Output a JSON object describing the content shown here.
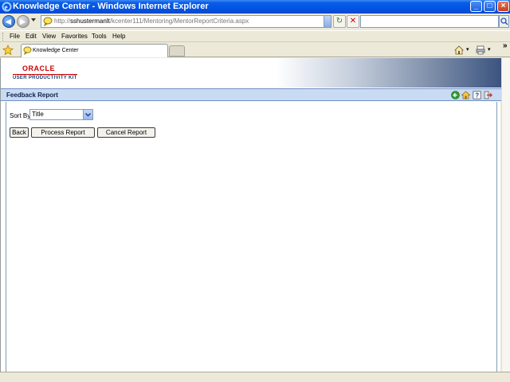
{
  "window": {
    "title": "Knowledge Center - Windows Internet Explorer",
    "min_icon": "minimize-icon",
    "max_icon": "maximize-icon",
    "close_icon": "close-icon"
  },
  "address": {
    "prefix": "http://",
    "host": "sshustermanlt",
    "path": "/kcenter111/Mentoring/MentorReportCriteria.aspx"
  },
  "menu": [
    "File",
    "Edit",
    "View",
    "Favorites",
    "Tools",
    "Help"
  ],
  "tab": {
    "label": "Knowledge Center"
  },
  "page": {
    "logo": "ORACLE",
    "product": "USER PRODUCTIVITY KIT",
    "title": "Feedback Report"
  },
  "form": {
    "sort_label": "Sort By",
    "sort_value": "Title",
    "buttons": {
      "back": "Back",
      "process": "Process Report",
      "cancel": "Cancel Report"
    }
  },
  "colors": {
    "titlebar": "#0054e3",
    "page_title_bar": "#c9dbf3",
    "oracle_red": "#cc0000",
    "upk_blue": "#1e3c72"
  }
}
